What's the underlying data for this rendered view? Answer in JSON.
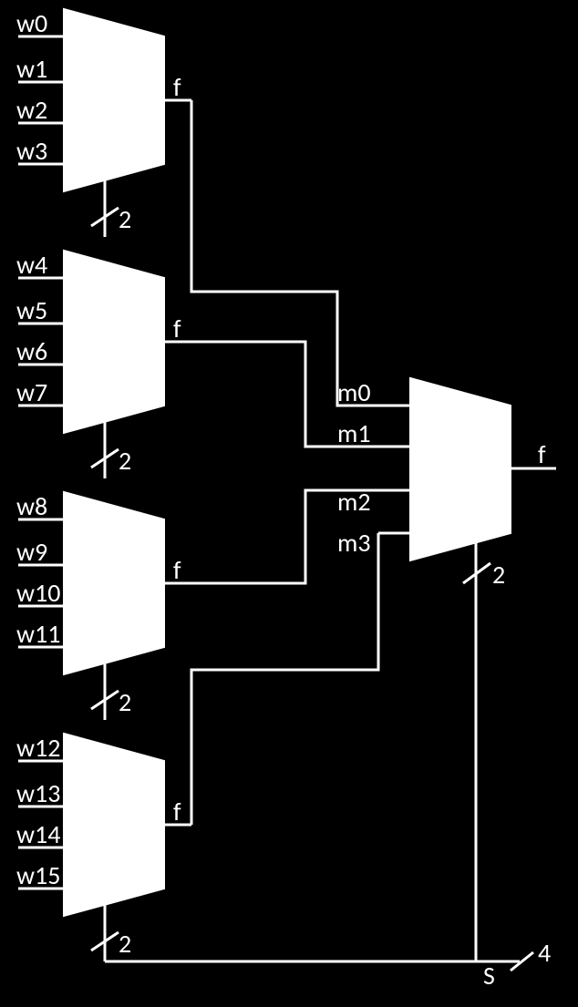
{
  "inputs": {
    "mux0": [
      "w0",
      "w1",
      "w2",
      "w3"
    ],
    "mux1": [
      "w4",
      "w5",
      "w6",
      "w7"
    ],
    "mux2": [
      "w8",
      "w9",
      "w10",
      "w11"
    ],
    "mux3": [
      "w12",
      "w13",
      "w14",
      "w15"
    ]
  },
  "stage_outputs": [
    "f",
    "f",
    "f",
    "f"
  ],
  "final_inputs": [
    "m0",
    "m1",
    "m2",
    "m3"
  ],
  "final_output": "f",
  "select_label": "S",
  "bus_width_small": "2",
  "bus_width_large": "4"
}
